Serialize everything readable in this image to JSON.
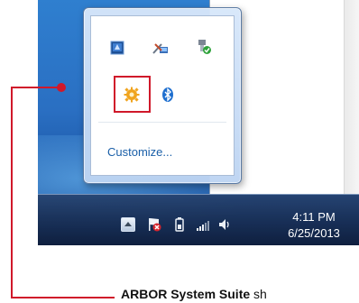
{
  "tray_flyout": {
    "icons": [
      {
        "name": "notebook-app-icon"
      },
      {
        "name": "network-tools-icon"
      },
      {
        "name": "safely-remove-hardware-icon"
      },
      {
        "name": "arbor-system-suite-gear-icon"
      },
      {
        "name": "bluetooth-icon"
      }
    ],
    "customize_label": "Customize..."
  },
  "taskbar": {
    "time": "4:11 PM",
    "date": "6/25/2013"
  },
  "caption": {
    "bold": "ARBOR System Suite",
    "rest": " sh"
  },
  "colors": {
    "highlight": "#d0182a",
    "link": "#1a5fa8"
  }
}
